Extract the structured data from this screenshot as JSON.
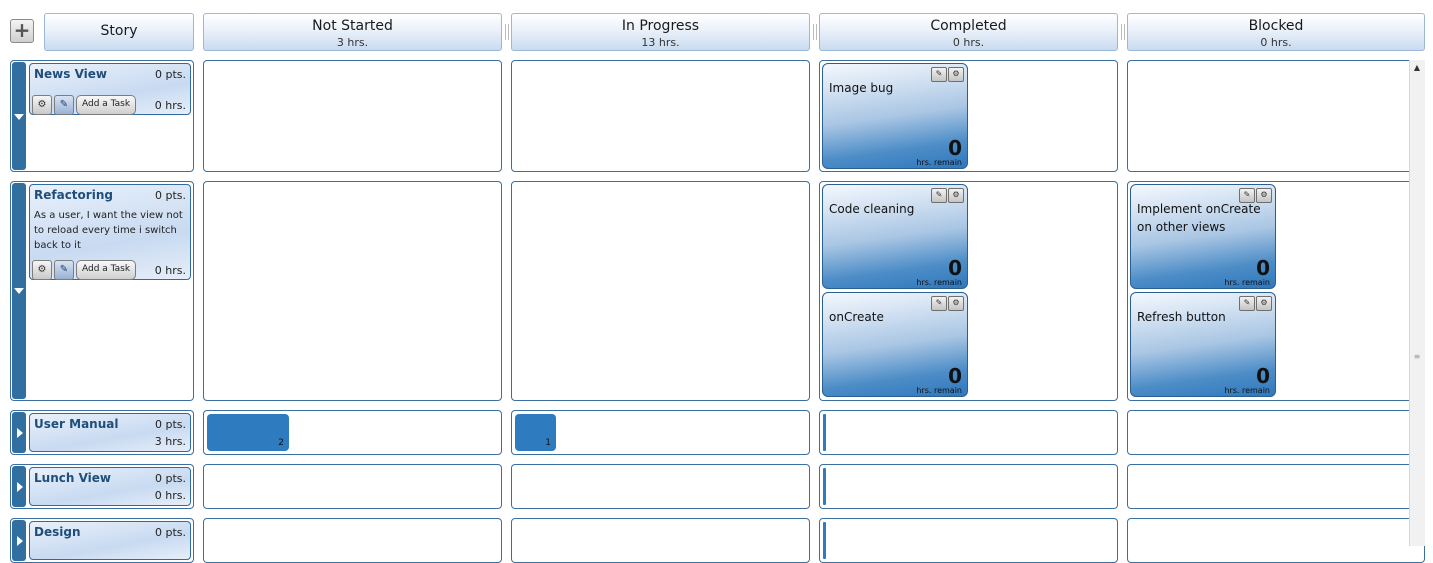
{
  "header": {
    "add_button": "+",
    "story_label": "Story",
    "columns": [
      {
        "title": "Not Started",
        "hours": "3 hrs."
      },
      {
        "title": "In Progress",
        "hours": "13 hrs."
      },
      {
        "title": "Completed",
        "hours": "0 hrs."
      },
      {
        "title": "Blocked",
        "hours": "0 hrs."
      }
    ]
  },
  "stories": [
    {
      "name": "News View",
      "points": "0 pts.",
      "hours": "0 hrs.",
      "description": "",
      "add_task_label": "Add a Task",
      "expanded": true
    },
    {
      "name": "Refactoring",
      "points": "0 pts.",
      "hours": "0 hrs.",
      "description": "As a user, I want the view not to reload every time i switch back to it",
      "add_task_label": "Add a Task",
      "expanded": true
    },
    {
      "name": "User Manual",
      "points": "0 pts.",
      "hours": "3 hrs.",
      "expanded": false
    },
    {
      "name": "Lunch View",
      "points": "0 pts.",
      "hours": "0 hrs.",
      "expanded": false
    },
    {
      "name": "Design",
      "points": "0 pts.",
      "hours": "",
      "expanded": false
    }
  ],
  "tasks": {
    "news_completed": [
      {
        "name": "Image bug",
        "remaining": "0",
        "remaining_label": "hrs. remain"
      }
    ],
    "refactoring_completed": [
      {
        "name": "Code cleaning",
        "remaining": "0",
        "remaining_label": "hrs. remain"
      },
      {
        "name": "onCreate",
        "remaining": "0",
        "remaining_label": "hrs. remain"
      }
    ],
    "refactoring_blocked": [
      {
        "name": "Implement onCreate on other views",
        "remaining": "0",
        "remaining_label": "hrs. remain"
      },
      {
        "name": "Refresh button",
        "remaining": "0",
        "remaining_label": "hrs. remain"
      }
    ]
  },
  "collapsed_summaries": {
    "user_manual": {
      "not_started_count": "2",
      "in_progress_count": "1"
    }
  },
  "icons": {
    "edit": "pencil-icon",
    "delete": "delete-icon",
    "expand": "chevron-right-icon",
    "collapse": "chevron-down-icon"
  },
  "colors": {
    "accent": "#316fa0",
    "task_gradient_bottom": "#2f78bd",
    "header_gradient": "#c9dbf0"
  }
}
